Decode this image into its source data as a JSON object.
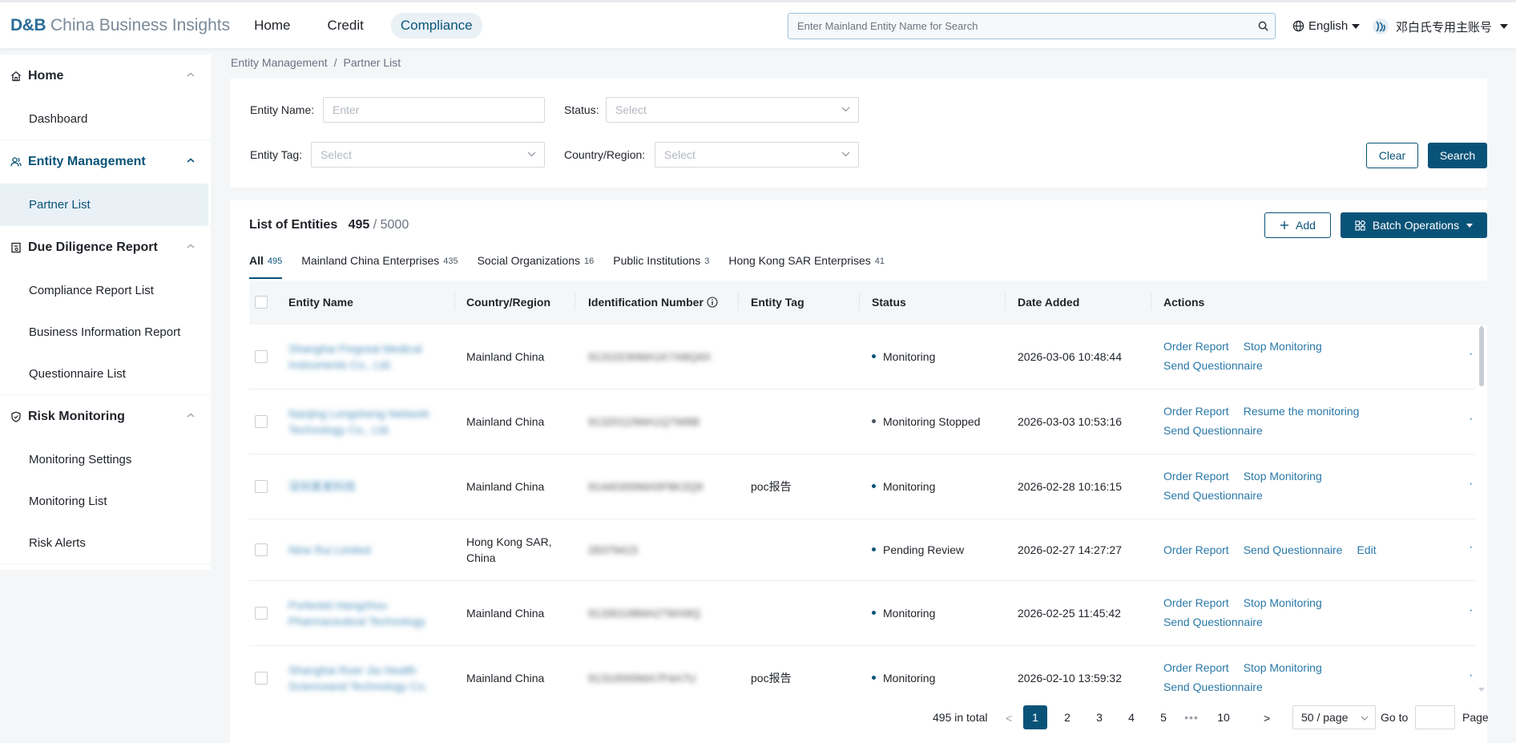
{
  "header": {
    "logo_db": "D&B",
    "logo_text": "China Business Insights",
    "nav": [
      "Home",
      "Credit",
      "Compliance"
    ],
    "search_placeholder": "Enter Mainland Entity Name for Search",
    "language": "English",
    "user": "邓白氏专用主账号"
  },
  "sidebar": {
    "groups": [
      {
        "label": "Home",
        "items": [
          "Dashboard"
        ]
      },
      {
        "label": "Entity Management",
        "items": [
          "Partner List"
        ]
      },
      {
        "label": "Due Diligence Report",
        "items": [
          "Compliance Report List",
          "Business Information Report",
          "Questionnaire List"
        ]
      },
      {
        "label": "Risk Monitoring",
        "items": [
          "Monitoring Settings",
          "Monitoring List",
          "Risk Alerts"
        ]
      }
    ]
  },
  "breadcrumb": [
    "Entity Management",
    "/",
    "Partner List"
  ],
  "filter": {
    "entity_name_label": "Entity Name",
    "entity_name_placeholder": "Enter",
    "status_label": "Status",
    "status_placeholder": "Select",
    "entity_tag_label": "Entity Tag",
    "entity_tag_placeholder": "Select",
    "country_label": "Country/Region",
    "country_placeholder": "Select",
    "clear": "Clear",
    "search": "Search"
  },
  "list": {
    "title": "List of Entities",
    "count": "495",
    "limit": "/ 5000",
    "add": "Add",
    "batch": "Batch Operations",
    "tabs": [
      {
        "label": "All",
        "count": "495"
      },
      {
        "label": "Mainland China Enterprises",
        "count": "435"
      },
      {
        "label": "Social Organizations",
        "count": "16"
      },
      {
        "label": "Public Institutions",
        "count": "3"
      },
      {
        "label": "Hong Kong SAR Enterprises",
        "count": "41"
      }
    ],
    "columns": [
      "Entity Name",
      "Country/Region",
      "Identification Number",
      "Entity Tag",
      "Status",
      "Date Added",
      "Actions"
    ],
    "rows": [
      {
        "name1": "Shanghai Fingreat Medical",
        "name2": "Instruments Co., Ltd.",
        "country1": "Mainland China",
        "country2": "",
        "idn": "91310230MA1K7A8Q4X",
        "tag": "",
        "status": "Monitoring",
        "stopped": false,
        "date": "2026-03-06 10:48:44",
        "a1": "Order Report",
        "a2": "Stop Monitoring",
        "a3": "Send Questionnaire"
      },
      {
        "name1": "Nanjing Longsheng Network",
        "name2": "Technology Co., Ltd.",
        "country1": "Mainland China",
        "country2": "",
        "idn": "91320115MA1Q7W8B",
        "tag": "",
        "status": "Monitoring Stopped",
        "stopped": true,
        "date": "2026-03-03 10:53:16",
        "a1": "Order Report",
        "a2": "Resume the monitoring",
        "a3": "Send Questionnaire"
      },
      {
        "name1": "深圳某某科技",
        "name2": "",
        "country1": "Mainland China",
        "country2": "",
        "idn": "91440300MA5F8K2Q9",
        "tag": "poc报告",
        "status": "Monitoring",
        "stopped": false,
        "date": "2026-02-28 10:16:15",
        "a1": "Order Report",
        "a2": "Stop Monitoring",
        "a3": "Send Questionnaire"
      },
      {
        "name1": "Nine Rui Limited",
        "name2": "",
        "country1": "Hong Kong SAR,",
        "country2": "China",
        "idn": "28379415",
        "tag": "",
        "status": "Pending Review",
        "stopped": false,
        "date": "2026-02-27 14:27:27",
        "a1": "Order Report",
        "a2": "Send Questionnaire",
        "a3": "Edit"
      },
      {
        "name1": "Porlentel Hangzhou",
        "name2": "Pharmaceutical Technology",
        "country1": "Mainland China",
        "country2": "",
        "idn": "91330108MA27WX8Q",
        "tag": "",
        "status": "Monitoring",
        "stopped": false,
        "date": "2026-02-25 11:45:42",
        "a1": "Order Report",
        "a2": "Stop Monitoring",
        "a3": "Send Questionnaire"
      },
      {
        "name1": "Shanghai Roer Jia Health",
        "name2": "Scienceand Technology Co.",
        "country1": "Mainland China",
        "country2": "",
        "idn": "91310000MA7F4A7U",
        "tag": "poc报告",
        "status": "Monitoring",
        "stopped": false,
        "date": "2026-02-10 13:59:32",
        "a1": "Order Report",
        "a2": "Stop Monitoring",
        "a3": "Send Questionnaire"
      }
    ]
  },
  "pager": {
    "total": "495 in total",
    "pages": [
      "1",
      "2",
      "3",
      "4",
      "5",
      "10"
    ],
    "page_size": "50 / page",
    "goto": "Go to",
    "page": "Page"
  }
}
